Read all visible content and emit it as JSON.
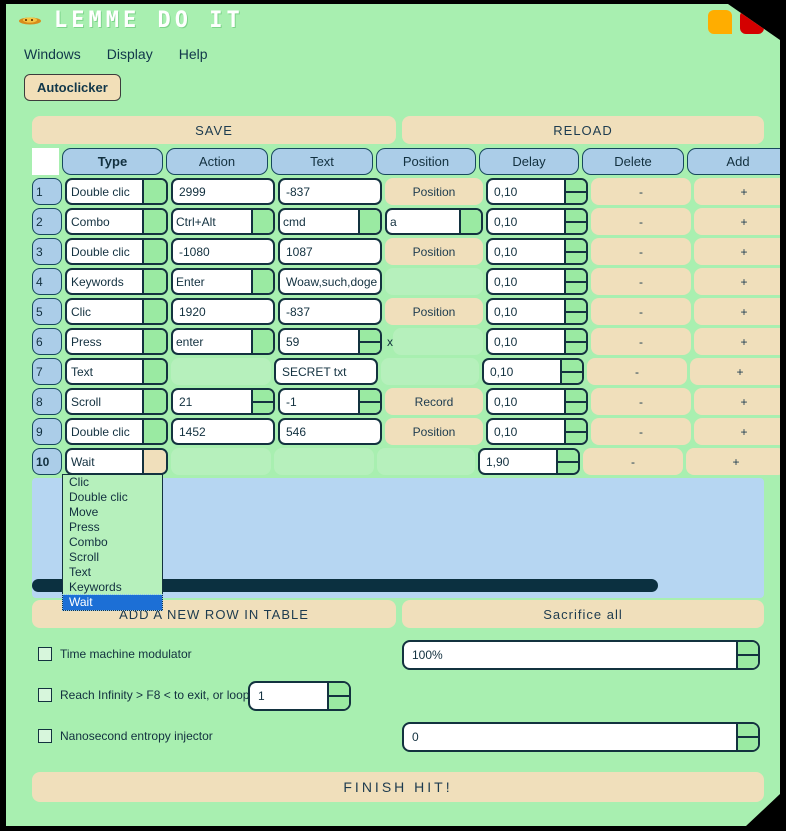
{
  "window": {
    "title": "LEMME DO IT",
    "icon": "pixel-ufo-icon",
    "minimize_label": "",
    "close_label": ""
  },
  "menu": {
    "items": [
      {
        "label": "Windows"
      },
      {
        "label": "Display"
      },
      {
        "label": "Help"
      }
    ]
  },
  "toolbar": {
    "autoclicker_label": "Autoclicker"
  },
  "actions": {
    "save_label": "SAVE",
    "reload_label": "RELOAD",
    "add_row_label": "ADD A NEW ROW IN TABLE",
    "sacrifice_label": "Sacrifice all",
    "finish_label": "FINISH HIT!"
  },
  "table": {
    "headers": [
      "",
      "Type",
      "Action",
      "Text",
      "Position",
      "Delay",
      "Delete",
      "Add"
    ],
    "active_header": "Type",
    "delete_symbol": "-",
    "add_symbol": "+",
    "rows": [
      {
        "num": "1",
        "type": "Double clic",
        "action": "2999",
        "action_kind": "input",
        "text": "-837",
        "text_kind": "input",
        "extra": "",
        "position": "Position",
        "position_kind": "button",
        "delay": "0,10"
      },
      {
        "num": "2",
        "type": "Combo",
        "action": "Ctrl+Alt",
        "action_kind": "combo",
        "text": "cmd",
        "text_kind": "combo",
        "extra": "a",
        "position": "",
        "position_kind": "combo",
        "delay": "0,10"
      },
      {
        "num": "3",
        "type": "Double clic",
        "action": "-1080",
        "action_kind": "input",
        "text": "1087",
        "text_kind": "input",
        "extra": "",
        "position": "Position",
        "position_kind": "button",
        "delay": "0,10"
      },
      {
        "num": "4",
        "type": "Keywords",
        "action": "Enter",
        "action_kind": "combo",
        "text": "Woaw,such,doge",
        "text_kind": "input",
        "extra": "",
        "position": "",
        "position_kind": "blank",
        "delay": "0,10"
      },
      {
        "num": "5",
        "type": "Clic",
        "action": "1920",
        "action_kind": "input",
        "text": "-837",
        "text_kind": "input",
        "extra": "",
        "position": "Position",
        "position_kind": "button",
        "delay": "0,10"
      },
      {
        "num": "6",
        "type": "Press",
        "action": "enter",
        "action_kind": "combo",
        "text": "59",
        "text_kind": "spin",
        "extra": "x",
        "position": "",
        "position_kind": "blank",
        "delay": "0,10"
      },
      {
        "num": "7",
        "type": "Text",
        "action": "",
        "action_kind": "blank",
        "text": "SECRET txt",
        "text_kind": "input",
        "extra": "",
        "position": "",
        "position_kind": "blank",
        "delay": "0,10"
      },
      {
        "num": "8",
        "type": "Scroll",
        "action": "21",
        "action_kind": "spin",
        "text": "-1",
        "text_kind": "spin",
        "extra": "",
        "position": "Record",
        "position_kind": "button",
        "delay": "0,10"
      },
      {
        "num": "9",
        "type": "Double clic",
        "action": "1452",
        "action_kind": "input",
        "text": "546",
        "text_kind": "input",
        "extra": "",
        "position": "Position",
        "position_kind": "button",
        "delay": "0,10"
      },
      {
        "num": "10",
        "type": "Wait",
        "action": "",
        "action_kind": "blank",
        "text": "",
        "text_kind": "blank",
        "extra": "",
        "position": "",
        "position_kind": "blank",
        "delay": "1,90"
      }
    ]
  },
  "type_dropdown": {
    "open": true,
    "selected": "Wait",
    "options": [
      "Clic",
      "Double clic",
      "Move",
      "Press",
      "Combo",
      "Scroll",
      "Text",
      "Keywords",
      "Wait"
    ]
  },
  "options_section": {
    "time_machine": {
      "label": "Time machine modulator",
      "checked": false,
      "value": "100%"
    },
    "reach_infinity": {
      "label": "Reach Infinity > F8 < to exit, or loop",
      "checked": false,
      "value": "1"
    },
    "nanosecond": {
      "label": "Nanosecond entropy injector",
      "checked": false,
      "value": "0"
    }
  },
  "colors": {
    "background_green": "#a8efb0",
    "panel_blue": "#b6d6f2",
    "header_blue": "#abcde8",
    "tan": "#f0dfbb",
    "dark": "#13323f",
    "accent_green": "#9aeaa2",
    "select_blue": "#1c6fd6",
    "minimize": "#ffad00",
    "close": "#d40000"
  }
}
